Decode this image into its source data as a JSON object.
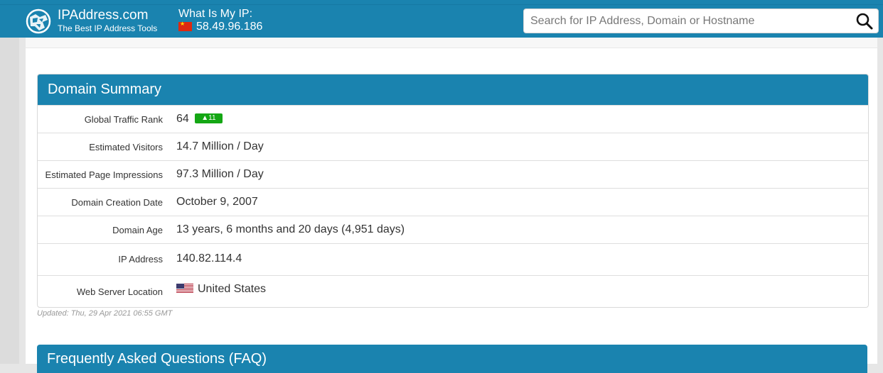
{
  "header": {
    "brand_name": "IPAddress.com",
    "brand_tagline": "The Best IP Address Tools",
    "my_ip_label": "What Is My IP:",
    "my_ip_value": "58.49.96.186",
    "search_placeholder": "Search for IP Address, Domain or Hostname",
    "accent_color": "#1a83af"
  },
  "summary": {
    "title": "Domain Summary",
    "rows": [
      {
        "label": "Global Traffic Rank",
        "value": "64",
        "badge": "11"
      },
      {
        "label": "Estimated Visitors",
        "value": "14.7 Million / Day"
      },
      {
        "label": "Estimated Page Impressions",
        "value": "97.3 Million / Day"
      },
      {
        "label": "Domain Creation Date",
        "value": "October 9, 2007"
      },
      {
        "label": "Domain Age",
        "value": "13 years, 6 months and 20 days (4,951 days)"
      },
      {
        "label": "IP Address",
        "value": "140.82.114.4"
      },
      {
        "label": "Web Server Location",
        "value": "United States"
      }
    ],
    "badge_color": "#14a714",
    "updated": "Updated: Thu, 29 Apr 2021 06:55 GMT"
  },
  "faq": {
    "title": "Frequently Asked Questions (FAQ)"
  }
}
